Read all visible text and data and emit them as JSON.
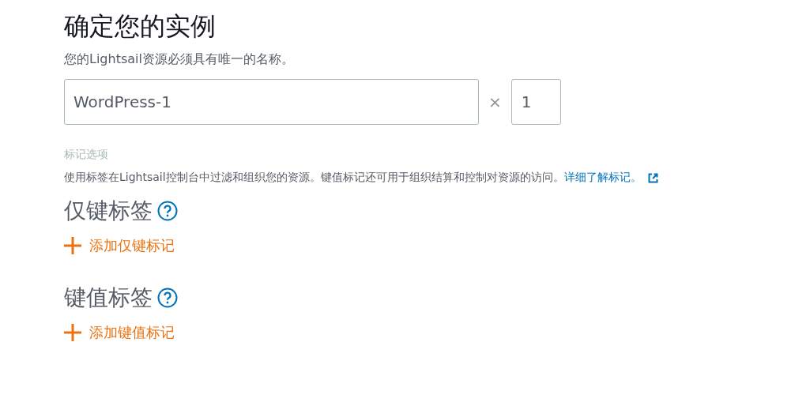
{
  "title": "确定您的实例",
  "subtitle": "您的Lightsail资源必须具有唯一的名称。",
  "name_field": {
    "value": "WordPress-1"
  },
  "multiplier": "×",
  "count_field": {
    "value": "1"
  },
  "tags": {
    "label": "标记选项",
    "description": "使用标签在Lightsail控制台中过滤和组织您的资源。键值标记还可用于组织结算和控制对资源的访问。",
    "link": "详细了解标记。"
  },
  "sections": [
    {
      "heading": "仅键标签",
      "add_link": "添加仅键标记"
    },
    {
      "heading": "键值标签",
      "add_link": "添加键值标记"
    }
  ]
}
